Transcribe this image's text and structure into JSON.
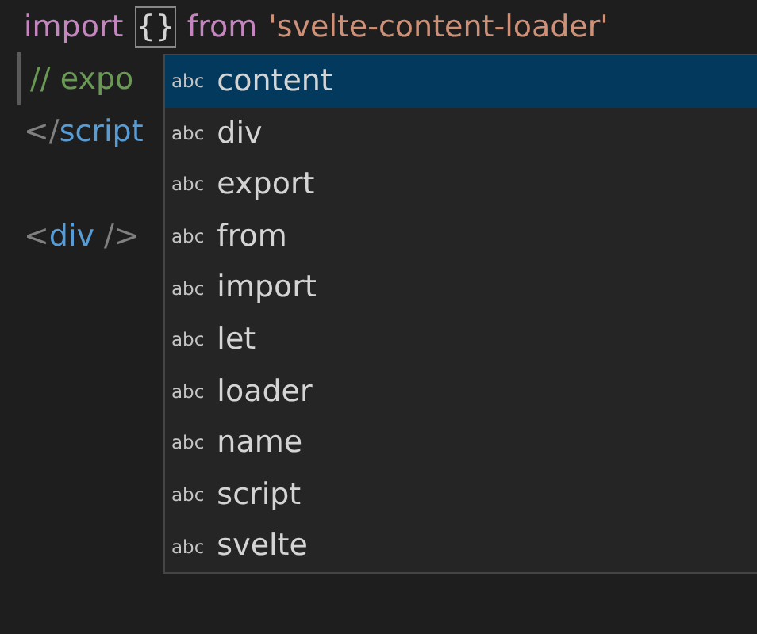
{
  "editor": {
    "lines": [
      {
        "kind": "code",
        "tokens": [
          {
            "kind": "keyword",
            "text": "import"
          },
          {
            "kind": "bracket",
            "text": "{}"
          },
          {
            "kind": "keyword",
            "text": "from"
          },
          {
            "kind": "string",
            "text": "'svelte-content-loader'"
          }
        ]
      },
      {
        "kind": "code",
        "cursor": true,
        "tokens": [
          {
            "kind": "comment",
            "text": "// expo"
          }
        ]
      },
      {
        "kind": "code",
        "tokens": [
          {
            "kind": "punct",
            "text": "</"
          },
          {
            "kind": "tag",
            "text": "script"
          }
        ]
      },
      {
        "kind": "blank"
      },
      {
        "kind": "code",
        "tokens": [
          {
            "kind": "punct",
            "text": "<"
          },
          {
            "kind": "tag",
            "text": "div"
          },
          {
            "kind": "punct",
            "text": " />"
          }
        ]
      }
    ]
  },
  "suggest": {
    "items": [
      {
        "icon": "abc",
        "label": "content",
        "selected": true
      },
      {
        "icon": "abc",
        "label": "div",
        "selected": false
      },
      {
        "icon": "abc",
        "label": "export",
        "selected": false
      },
      {
        "icon": "abc",
        "label": "from",
        "selected": false
      },
      {
        "icon": "abc",
        "label": "import",
        "selected": false
      },
      {
        "icon": "abc",
        "label": "let",
        "selected": false
      },
      {
        "icon": "abc",
        "label": "loader",
        "selected": false
      },
      {
        "icon": "abc",
        "label": "name",
        "selected": false
      },
      {
        "icon": "abc",
        "label": "script",
        "selected": false
      },
      {
        "icon": "abc",
        "label": "svelte",
        "selected": false
      }
    ]
  }
}
